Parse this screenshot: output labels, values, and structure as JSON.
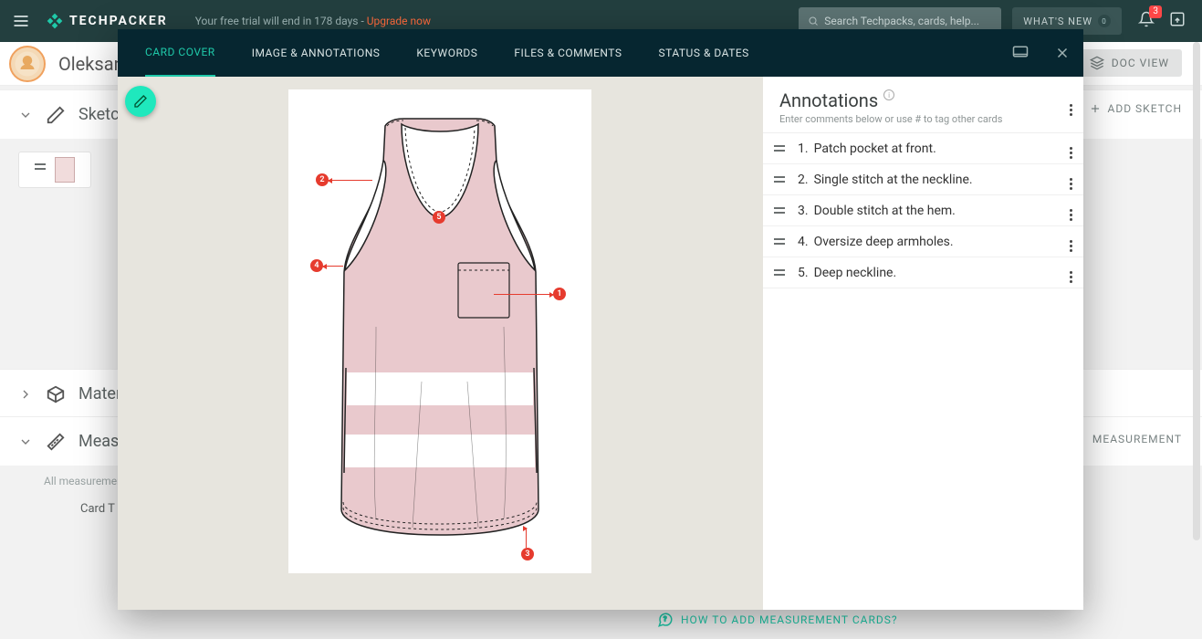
{
  "topbar": {
    "brand": "TECHPACKER",
    "trial_prefix": "Your free trial will end in 178 days - ",
    "upgrade": "Upgrade now",
    "search_placeholder": "Search Techpacks, cards, help...",
    "whats_new": "WHAT'S NEW",
    "whats_new_count": "0",
    "bell_count": "3"
  },
  "secondbar": {
    "username": "Oleksan",
    "docview": "DOC VIEW"
  },
  "sections": {
    "sketch": "Sketch",
    "material": "Materi",
    "measure": "Measu",
    "add_sketch": "ADD SKETCH",
    "add_measurement": "MEASUREMENT",
    "all_meas_note": "All measurement",
    "card_title": "Card T",
    "help_meas": "HOW TO ADD MEASUREMENT CARDS?"
  },
  "modal": {
    "tabs": {
      "cover": "CARD COVER",
      "image": "IMAGE & ANNOTATIONS",
      "keywords": "KEYWORDS",
      "files": "FILES & COMMENTS",
      "status": "STATUS & DATES"
    },
    "annotations": {
      "title": "Annotations",
      "subtitle": "Enter comments below or use # to tag other cards",
      "items": [
        {
          "n": "1.",
          "text": "Patch pocket at front."
        },
        {
          "n": "2.",
          "text": "Single stitch at the neckline."
        },
        {
          "n": "3.",
          "text": "Double stitch at the hem."
        },
        {
          "n": "4.",
          "text": "Oversize deep armholes."
        },
        {
          "n": "5.",
          "text": "Deep neckline."
        }
      ]
    }
  }
}
